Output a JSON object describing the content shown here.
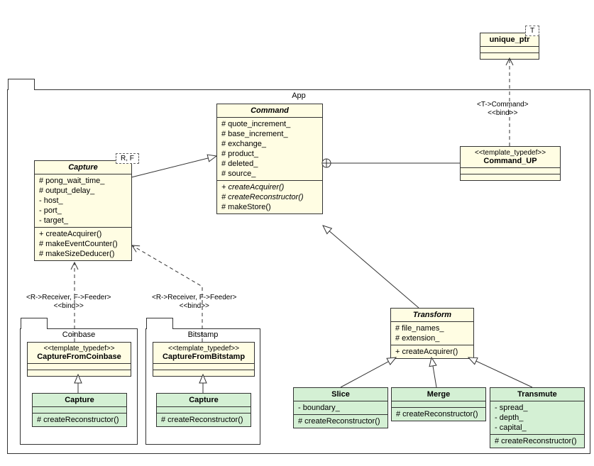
{
  "packages": {
    "app": "App",
    "coinbase": "Coinbase",
    "bitstamp": "Bitstamp"
  },
  "templates": {
    "captureRF": "R, F",
    "uniqueT": "T"
  },
  "classes": {
    "Command": {
      "name": "Command",
      "attrs": [
        "# quote_increment_",
        "# base_increment_",
        "# exchange_",
        "# product_",
        "# deleted_",
        "# source_"
      ],
      "ops": [
        "+ createAcquirer()",
        "# createReconstructor()",
        "# makeStore()"
      ]
    },
    "Capture": {
      "name": "Capture",
      "attrs": [
        "# pong_wait_time_",
        "# output_delay_",
        "-  host_",
        "-  port_",
        "-  target_"
      ],
      "ops": [
        "+ createAcquirer()",
        "# makeEventCounter()",
        "# makeSizeDeducer()"
      ]
    },
    "unique_ptr": {
      "name": "unique_ptr"
    },
    "Command_UP": {
      "stereotype": "<<template_typedef>>",
      "name": "Command_UP"
    },
    "Transform": {
      "name": "Transform",
      "attrs": [
        "# file_names_",
        "# extension_"
      ],
      "ops": [
        "+ createAcquirer()"
      ]
    },
    "CaptureFromCoinbase": {
      "stereotype": "<<template_typedef>>",
      "name": "CaptureFromCoinbase"
    },
    "CaptureFromBitstamp": {
      "stereotype": "<<template_typedef>>",
      "name": "CaptureFromBitstamp"
    },
    "CaptureCoinbase": {
      "name": "Capture",
      "ops": [
        "# createReconstructor()"
      ]
    },
    "CaptureBitstamp": {
      "name": "Capture",
      "ops": [
        "# createReconstructor()"
      ]
    },
    "Slice": {
      "name": "Slice",
      "attrs": [
        "-  boundary_"
      ],
      "ops": [
        "# createReconstructor()"
      ]
    },
    "Merge": {
      "name": "Merge",
      "ops": [
        "# createReconstructor()"
      ]
    },
    "Transmute": {
      "name": "Transmute",
      "attrs": [
        "-  spread_",
        "-  depth_",
        "-  capital_"
      ],
      "ops": [
        "# createReconstructor()"
      ]
    }
  },
  "edges": {
    "bindT": {
      "line1": "<T->Command>",
      "line2": "<<bind>>"
    },
    "bindRF": {
      "line1": "<R->Receiver, F->Feeder>",
      "line2": "<<bind>>"
    }
  }
}
